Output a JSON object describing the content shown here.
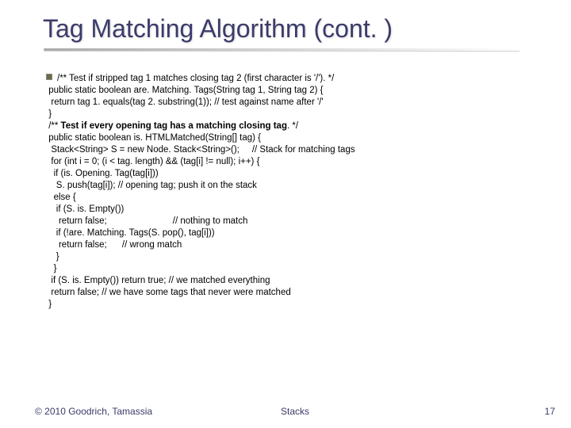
{
  "title": "Tag Matching Algorithm (cont. )",
  "code": {
    "l1": "/** Test if stripped tag 1 matches closing tag 2 (first character is '/'). */",
    "l2": " public static boolean are. Matching. Tags(String tag 1, String tag 2) {",
    "l3": "  return tag 1. equals(tag 2. substring(1)); // test against name after '/'",
    "l4": " }",
    "l5a": " /** ",
    "l5b": "Test if every opening tag has a matching closing tag",
    "l5c": ". */",
    "l6": " public static boolean is. HTMLMatched(String[] tag) {",
    "l7": "  Stack<String> S = new Node. Stack<String>();     // Stack for matching tags",
    "l8": "  for (int i = 0; (i < tag. length) && (tag[i] != null); i++) {",
    "l9": "   if (is. Opening. Tag(tag[i]))",
    "l10": "    S. push(tag[i]); // opening tag; push it on the stack",
    "l11": "   else {",
    "l12": "    if (S. is. Empty())",
    "l13": "     return false;                          // nothing to match",
    "l14": "    if (!are. Matching. Tags(S. pop(), tag[i]))",
    "l15": "     return false;      // wrong match",
    "l16": "    }",
    "l17": "   }",
    "l18": "  if (S. is. Empty()) return true; // we matched everything",
    "l19": "  return false; // we have some tags that never were matched",
    "l20": " }"
  },
  "footer": {
    "left": "© 2010 Goodrich, Tamassia",
    "center": "Stacks",
    "right": "17"
  }
}
